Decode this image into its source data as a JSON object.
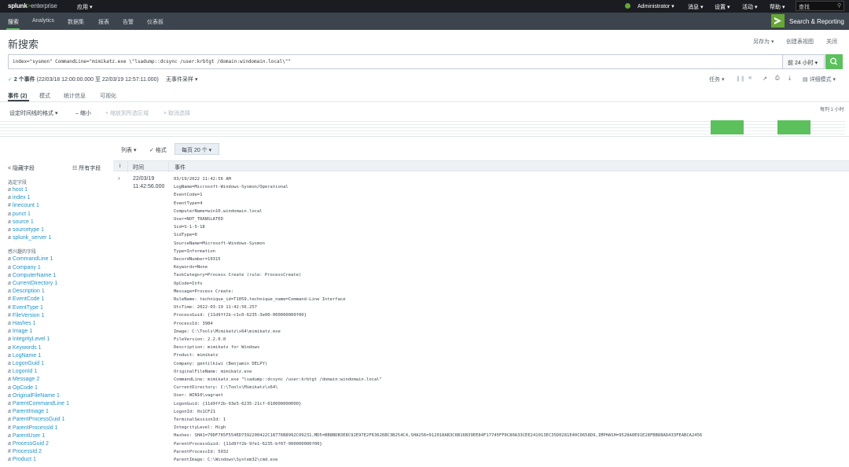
{
  "topbar": {
    "logo": {
      "splunk": "splunk",
      "gt": ">",
      "enterprise": "enterprise"
    },
    "app_menu": "应用 ▾",
    "user": "Administrator ▾",
    "messages": "消息 ▾",
    "settings": "设置 ▾",
    "activity": "活动 ▾",
    "help": "帮助 ▾",
    "search_placeholder": "查找"
  },
  "appbar": {
    "nav": [
      "搜索",
      "Analytics",
      "数据集",
      "报表",
      "告警",
      "仪表板"
    ],
    "app_title": "Search & Reporting"
  },
  "header": {
    "title": "新搜索",
    "save_as": "另存为 ▾",
    "create_dashboard": "创建表视图",
    "close": "关闭"
  },
  "search": {
    "query": "index=\"sysmon\"  CommandLine=\"mimikatz.exe  \\\"lsadump::dcsync /user:krbtgt /domain:windomain.local\\\"\"",
    "time_range": "前 24 小时 ▾"
  },
  "status": {
    "check": "✓",
    "count": "2 个事件",
    "range": "(22/03/18 12:00:00.000 至 22/03/19 12:57:11.000)",
    "sampling": "无事件采样 ▾",
    "job": "任务 ▾",
    "mode": "详细模式 ▾"
  },
  "tabs": [
    "事件 (2)",
    "模式",
    "统计信息",
    "可视化"
  ],
  "timeline": {
    "format": "设定时间线的格式 ▾",
    "zoom_out": "– 缩小",
    "zoom_selection": "+ 缩放到所选区域",
    "deselect": "× 取消选择",
    "scale_label": "每列 1 小时",
    "bucket_counts": [
      1,
      1
    ]
  },
  "events_toolbar": {
    "list": "列表 ▾",
    "format": "✓ 格式",
    "per_page": "每页 20 个 ▾"
  },
  "fields": {
    "hide": "< 隐藏字段",
    "all": "☷ 所有字段",
    "selected_title": "选定字段",
    "selected": [
      {
        "type": "a",
        "name": "host",
        "count": "1"
      },
      {
        "type": "a",
        "name": "index",
        "count": "1"
      },
      {
        "type": "#",
        "name": "linecount",
        "count": "1"
      },
      {
        "type": "a",
        "name": "punct",
        "count": "1"
      },
      {
        "type": "a",
        "name": "source",
        "count": "1"
      },
      {
        "type": "a",
        "name": "sourcetype",
        "count": "1"
      },
      {
        "type": "a",
        "name": "splunk_server",
        "count": "1"
      }
    ],
    "interesting_title": "感兴趣的字段",
    "interesting": [
      {
        "type": "a",
        "name": "CommandLine",
        "count": "1"
      },
      {
        "type": "a",
        "name": "Company",
        "count": "1"
      },
      {
        "type": "a",
        "name": "ComputerName",
        "count": "1"
      },
      {
        "type": "a",
        "name": "CurrentDirectory",
        "count": "1"
      },
      {
        "type": "a",
        "name": "Description",
        "count": "1"
      },
      {
        "type": "#",
        "name": "EventCode",
        "count": "1"
      },
      {
        "type": "#",
        "name": "EventType",
        "count": "1"
      },
      {
        "type": "#",
        "name": "FileVersion",
        "count": "1"
      },
      {
        "type": "a",
        "name": "Hashes",
        "count": "1"
      },
      {
        "type": "a",
        "name": "Image",
        "count": "1"
      },
      {
        "type": "a",
        "name": "IntegrityLevel",
        "count": "1"
      },
      {
        "type": "a",
        "name": "Keywords",
        "count": "1"
      },
      {
        "type": "a",
        "name": "LogName",
        "count": "1"
      },
      {
        "type": "a",
        "name": "LogonGuid",
        "count": "1"
      },
      {
        "type": "a",
        "name": "LogonId",
        "count": "1"
      },
      {
        "type": "a",
        "name": "Message",
        "count": "2"
      },
      {
        "type": "a",
        "name": "OpCode",
        "count": "1"
      },
      {
        "type": "a",
        "name": "OriginalFileName",
        "count": "1"
      },
      {
        "type": "a",
        "name": "ParentCommandLine",
        "count": "1"
      },
      {
        "type": "a",
        "name": "ParentImage",
        "count": "1"
      },
      {
        "type": "a",
        "name": "ParentProcessGuid",
        "count": "1"
      },
      {
        "type": "#",
        "name": "ParentProcessId",
        "count": "1"
      },
      {
        "type": "a",
        "name": "ParentUser",
        "count": "1"
      },
      {
        "type": "a",
        "name": "ProcessGuid",
        "count": "2"
      },
      {
        "type": "#",
        "name": "ProcessId",
        "count": "2"
      },
      {
        "type": "a",
        "name": "Product",
        "count": "1"
      }
    ]
  },
  "table": {
    "col_info": "i",
    "col_time": "时间",
    "col_event": "事件"
  },
  "event": {
    "expand": "›",
    "date": "22/03/19",
    "time": "11:42:56.000",
    "lines": [
      "03/19/2022 11:42:56 AM",
      "LogName=Microsoft-Windows-Sysmon/Operational",
      "EventCode=1",
      "EventType=4",
      "ComputerName=win10.windomain.local",
      "User=NOT_TRANSLATED",
      "Sid=S-1-5-18",
      "SidType=0",
      "SourceName=Microsoft-Windows-Sysmon",
      "Type=Information",
      "RecordNumber=10315",
      "Keywords=None",
      "TaskCategory=Process Create (rule: ProcessCreate)",
      "OpCode=Info",
      "Message=Process Create:",
      "RuleName: technique_id=T1059,technique_name=Command-Line Interface",
      "UtcTime: 2022-03-19 11:42:56.257",
      "ProcessGuid: {11d9ff2b-c1c0-6235-3e00-000000000f00}",
      "ProcessId: 3984",
      "Image: C:\\Tools\\Mimikatz\\x64\\mimikatz.exe",
      "FileVersion: 2.2.0.0",
      "Description: mimikatz for Windows",
      "Product: mimikatz",
      "Company: gentilkiwi (Benjamin DELPY)",
      "OriginalFileName: mimikatz.exe",
      "CommandLine: mimikatz.exe  \"lsadump::dcsync /user:krbtgt /domain:windomain.local\"",
      "CurrentDirectory: C:\\Tools\\Mimikatz\\x64\\",
      "User: WIN10\\vagrant",
      "LogonGuid: {11d9ff2b-93e5-6235-21cf-010000000000}",
      "LogonId: 0x1CF21",
      "TerminalSessionId: 1",
      "IntegrityLevel: High",
      "Hashes: SHA1=70DF765F554ED7392200422C18776B8992C09231,MD5=BB8BDB3E8C92E97E2F63626BC3B254C4,SHA256=912018AB3C6B16B39EE84F17745FF0C80A33CEE241013EC35D0281E40C0658D9,IMPHASH=9528A0E91E28FBB88AD433FEABCA2456",
      "ParentProcessGuid: {11d9ff2b-9fe1-6235-bf07-000000000f00}",
      "ParentProcessId: 5032",
      "ParentImage: C:\\Windows\\System32\\cmd.exe"
    ]
  },
  "colors": {
    "topbar": "#1a1c21",
    "appbar": "#3c444d",
    "accent_green": "#5cc05c",
    "link_blue": "#1e93c6"
  }
}
